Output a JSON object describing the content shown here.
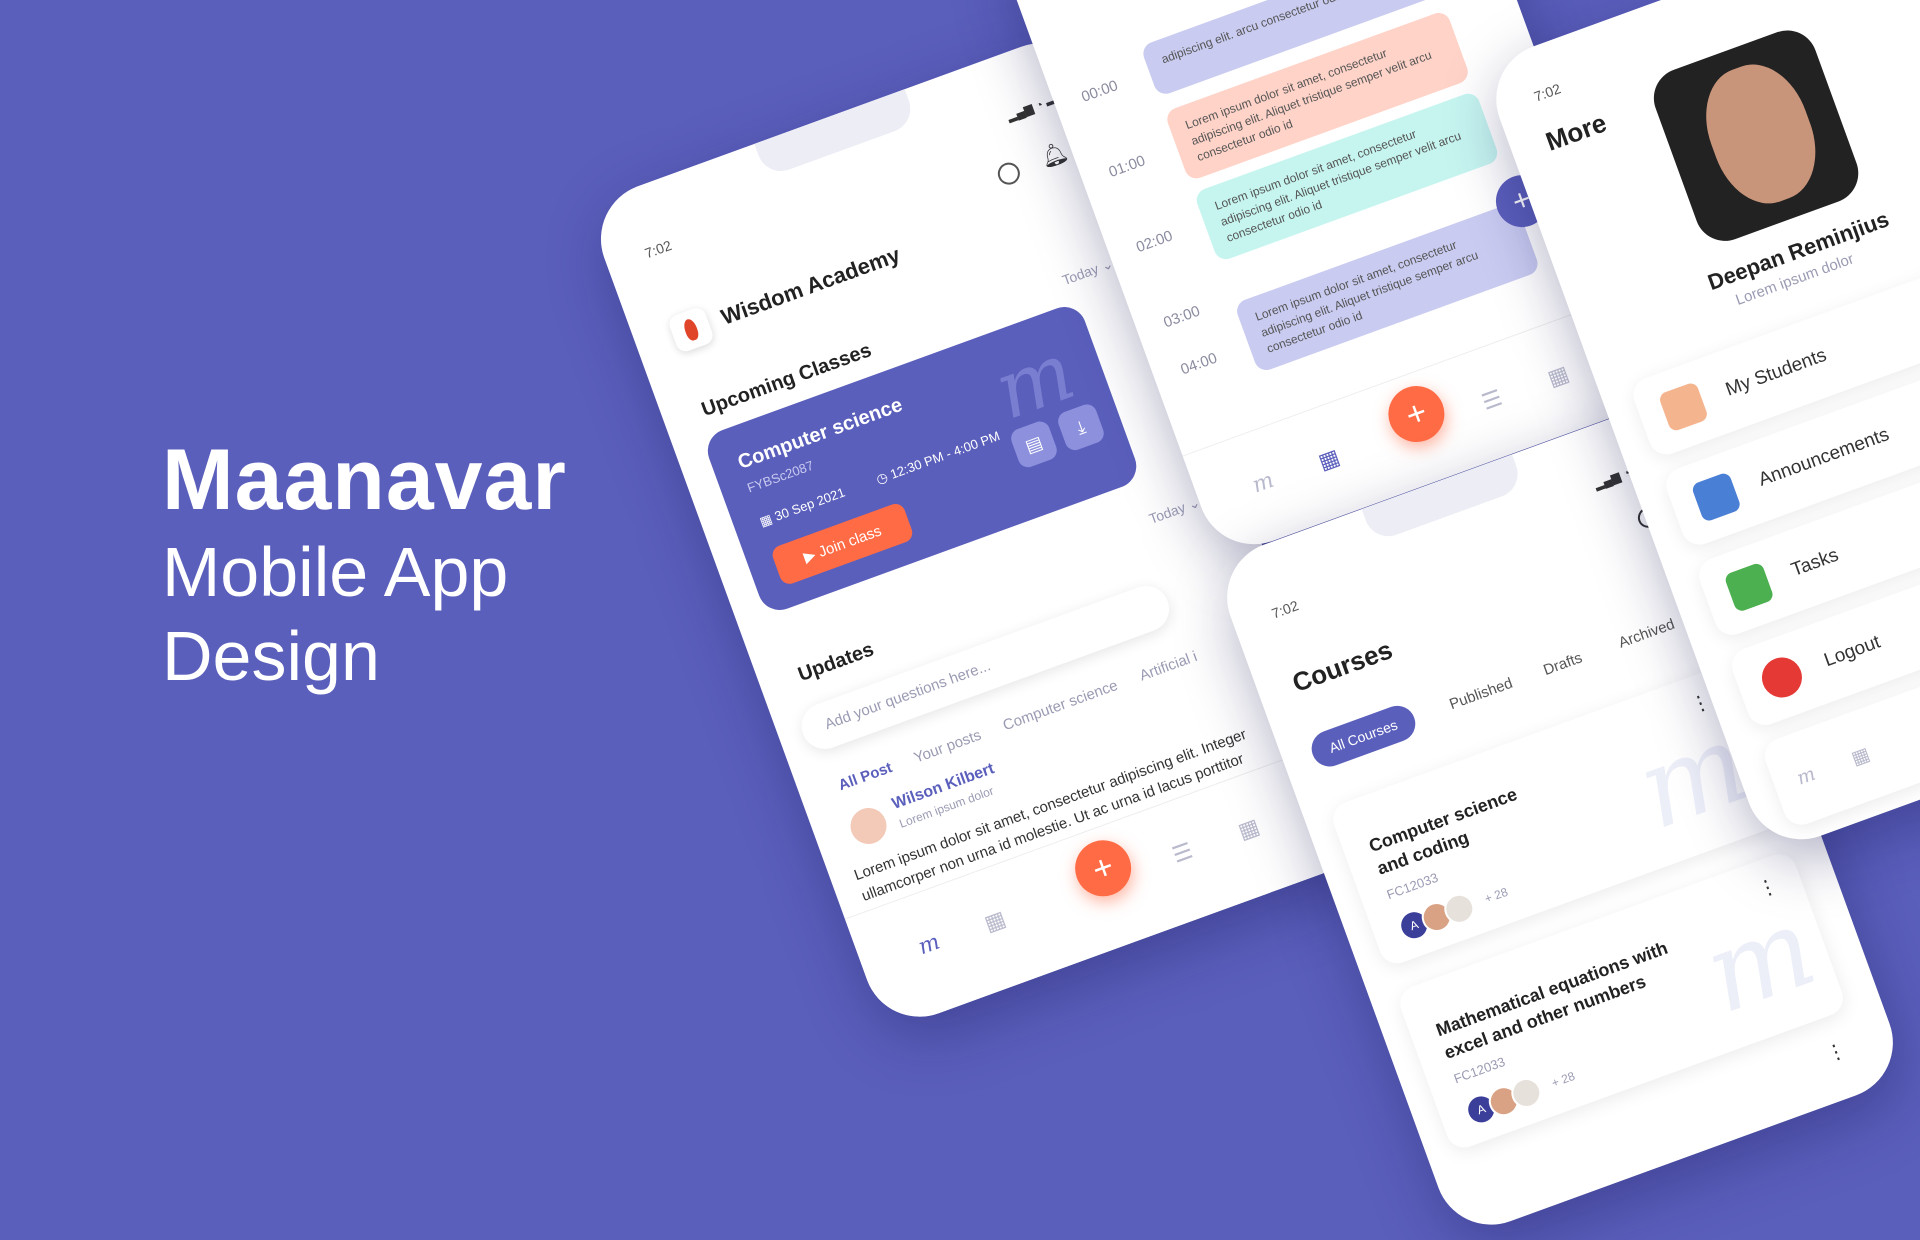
{
  "hero": {
    "title": "Maanavar",
    "subtitle_line1": "Mobile App",
    "subtitle_line2": "Design"
  },
  "colors": {
    "bg": "#5b5fbc",
    "accent": "#ff6b45"
  },
  "home": {
    "status_time": "7:02",
    "app_name": "Wisdom Academy",
    "upcoming_title": "Upcoming Classes",
    "today_filter": "Today",
    "class_card": {
      "subject": "Computer science",
      "code": "FYBSc2087",
      "date": "30 Sep 2021",
      "time": "12:30 PM - 4:00 PM",
      "join_label": "Join class"
    },
    "updates_title": "Updates",
    "updates_filter": "Today",
    "search_placeholder": "Add your questions here...",
    "tabs": [
      "All Post",
      "Your posts",
      "Computer science",
      "Artificial i"
    ],
    "post": {
      "author": "Wilson Kilbert",
      "author_sub": "Lorem ipsum dolor",
      "body": "Lorem ipsum dolor sit amet, consectetur adipiscing elit. Integer ullamcorper non urna id molestie. Ut ac urna id lacus porttitor imperdiet. Phasellus sed nisi enim. Fusce vel dignissim diam, a pretium turpis. Nulla varius finibus neque"
    },
    "fab_label": "+"
  },
  "schedule": {
    "hours": [
      "00:00",
      "01:00",
      "02:00",
      "03:00",
      "04:00"
    ],
    "slot_top_text": "adipiscing elit. arcu consectetur odio",
    "slot_text": "Lorem ipsum dolor sit amet, consectetur adipiscing elit. Aliquet tristique semper velit arcu consectetur odio id",
    "slot_last_text": "Lorem ipsum dolor sit amet, consectetur adipiscing elit. Aliquet tristique semper arcu consectetur odio id",
    "fab_label": "+"
  },
  "courses": {
    "status_time": "7:02",
    "title": "Courses",
    "tabs": [
      "All Courses",
      "Published",
      "Drafts",
      "Archived"
    ],
    "items": [
      {
        "title_l1": "Computer science",
        "title_l2": "and coding",
        "code": "FC12033",
        "more": "+ 28",
        "avatar_letter": "A"
      },
      {
        "title_l1": "Mathematical equations with",
        "title_l2": "excel and other numbers",
        "code": "FC12033",
        "more": "+ 28",
        "avatar_letter": "A"
      }
    ]
  },
  "more": {
    "status_time": "7:02",
    "title": "More",
    "user_name": "Deepan Reminjius",
    "user_sub": "Lorem ipsum dolor",
    "items": [
      "My Students",
      "Announcements",
      "Tasks",
      "Logout"
    ]
  }
}
